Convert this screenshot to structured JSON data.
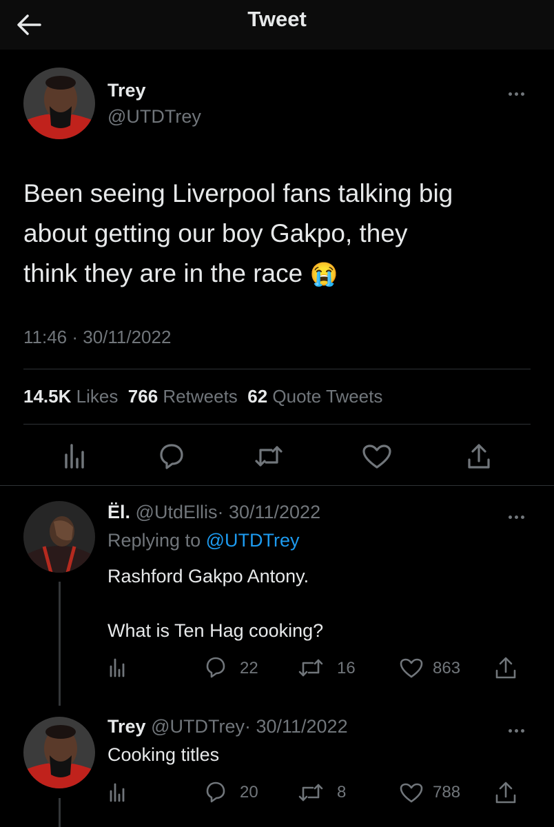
{
  "header": {
    "title": "Tweet"
  },
  "main_tweet": {
    "name": "Trey",
    "handle": "@UTDTrey",
    "text_line1": "Been seeing Liverpool fans talking big",
    "text_line2": "about getting our boy Gakpo, they",
    "text_line3": "think they are in the race",
    "emoji": "😭",
    "timestamp": "11:46 · 30/11/2022",
    "likes_count": "14.5K",
    "likes_label": "Likes",
    "retweets_count": "766",
    "retweets_label": "Retweets",
    "quotes_count": "62",
    "quotes_label": "Quote Tweets"
  },
  "replies": [
    {
      "name": "Ël.",
      "handle": "@UtdEllis",
      "date": "· 30/11/2022",
      "replying_prefix": "Replying to",
      "replying_to": "@UTDTrey",
      "text_line1": "Rashford Gakpo Antony.",
      "text_line2": "What is Ten Hag cooking?",
      "replies_count": "22",
      "retweets_count": "16",
      "likes_count": "863"
    },
    {
      "name": "Trey",
      "handle": "@UTDTrey",
      "date": "· 30/11/2022",
      "text_line1": "Cooking titles",
      "replies_count": "20",
      "retweets_count": "8",
      "likes_count": "788"
    }
  ],
  "colors": {
    "background": "#000000",
    "text": "#e7e9ea",
    "muted": "#71767b",
    "accent": "#1d9bf0"
  }
}
